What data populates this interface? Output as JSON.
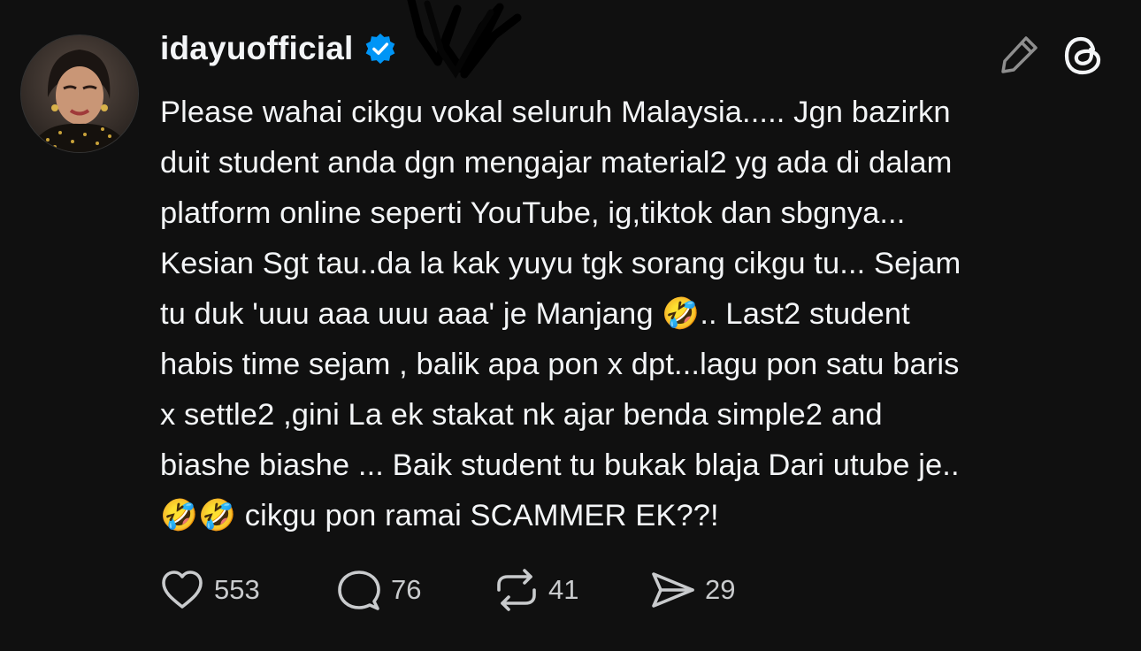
{
  "post": {
    "username": "idayuofficial",
    "verified": true,
    "text": "Please wahai cikgu vokal seluruh Malaysia..... Jgn bazirkn\nduit student anda dgn mengajar material2 yg ada di dalam\nplatform online seperti YouTube, ig,tiktok dan sbgnya...\nKesian Sgt tau..da la kak yuyu tgk sorang cikgu tu... Sejam\ntu duk 'uuu aaa uuu aaa' je Manjang 🤣.. Last2 student\nhabis time sejam , balik apa pon x dpt...lagu pon satu baris\nx settle2 ,gini La ek stakat nk ajar benda simple2 and\nbiashe biashe ... Baik student tu bukak blaja Dari utube je..\n🤣🤣 cikgu pon ramai SCAMMER EK??!"
  },
  "actions": {
    "likes": "553",
    "replies": "76",
    "reposts": "41",
    "shares": "29"
  },
  "icons": {
    "verified": "verified-badge-icon",
    "edit": "pencil-icon",
    "app": "threads-logo-icon",
    "like": "heart-icon",
    "reply": "comment-bubble-icon",
    "repost": "repost-icon",
    "share": "send-icon"
  },
  "colors": {
    "background": "#101010",
    "text": "#f3f5f7",
    "secondary": "#c9cbcd",
    "verified": "#0095f6"
  }
}
